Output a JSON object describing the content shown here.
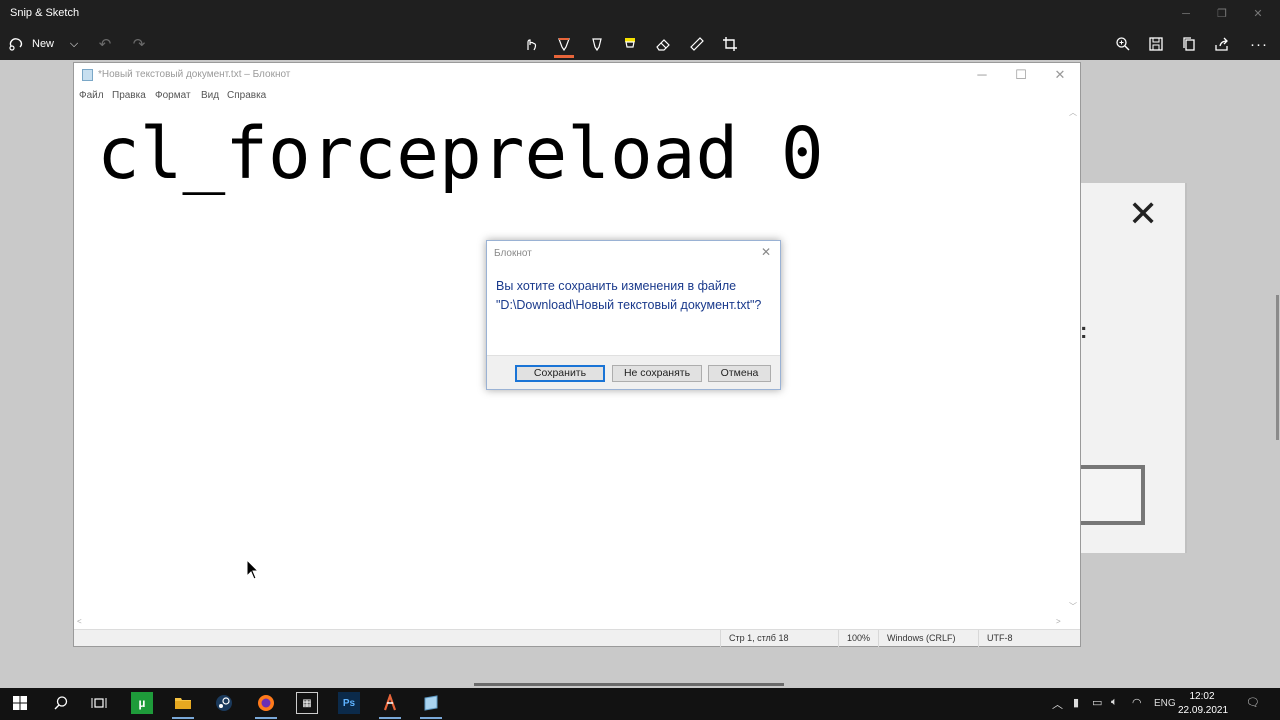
{
  "app": {
    "title": "Snip & Sketch",
    "new_label": "New"
  },
  "notepad": {
    "title": "*Новый текстовый документ.txt – Блокнот",
    "menu": [
      "Файл",
      "Правка",
      "Формат",
      "Вид",
      "Справка"
    ],
    "content": "cl_forcepreload 0",
    "status": {
      "position": "Стр 1, стлб 18",
      "zoom": "100%",
      "line_endings": "Windows (CRLF)",
      "encoding": "UTF-8"
    }
  },
  "dialog": {
    "title": "Блокнот",
    "message": "Вы хотите сохранить изменения в файле \"D:\\Download\\Новый текстовый документ.txt\"?",
    "buttons": [
      "Сохранить",
      "Не сохранять",
      "Отмена"
    ]
  },
  "taskbar": {
    "language": "ENG",
    "time": "12:02",
    "date": "22.09.2021"
  },
  "colors": {
    "dialog_text": "#1a3a8c",
    "primary_border": "#1a74d6",
    "pen_accent": "#e8653a",
    "taskbar_bg": "#121212"
  }
}
